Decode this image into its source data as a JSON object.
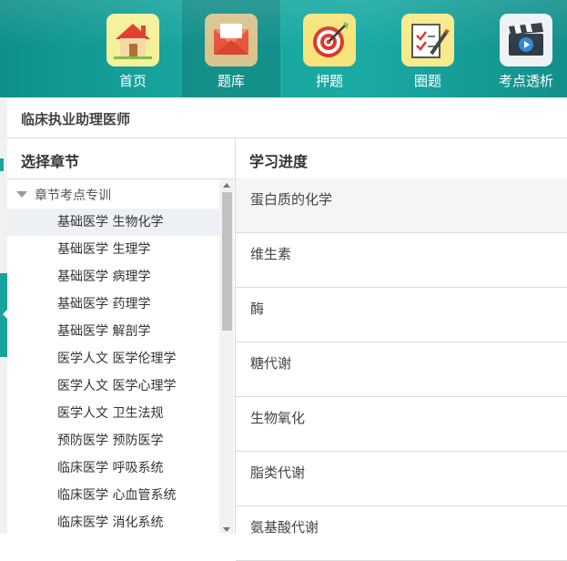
{
  "nav": {
    "items": [
      {
        "label": "首页",
        "icon": "home-icon"
      },
      {
        "label": "题库",
        "icon": "envelope-icon"
      },
      {
        "label": "押题",
        "icon": "target-icon"
      },
      {
        "label": "圈题",
        "icon": "clipboard-pen-icon"
      },
      {
        "label": "考点透析",
        "icon": "video-clapper-icon"
      }
    ],
    "active_index": 1
  },
  "subheader": {
    "title": "临床执业助理医师"
  },
  "left": {
    "title": "选择章节",
    "root": "章节考点专训",
    "items": [
      "基础医学 生物化学",
      "基础医学 生理学",
      "基础医学 病理学",
      "基础医学 药理学",
      "基础医学 解剖学",
      "医学人文 医学伦理学",
      "医学人文 医学心理学",
      "医学人文 卫生法规",
      "预防医学 预防医学",
      "临床医学 呼吸系统",
      "临床医学 心血管系统",
      "临床医学 消化系统"
    ],
    "selected_index": 0
  },
  "right": {
    "title": "学习进度",
    "rows": [
      "蛋白质的化学",
      "维生素",
      "酶",
      "糖代谢",
      "生物氧化",
      "脂类代谢",
      "氨基酸代谢"
    ]
  },
  "colors": {
    "teal": "#1aa7a1",
    "selected_row": "#edf1f5"
  }
}
